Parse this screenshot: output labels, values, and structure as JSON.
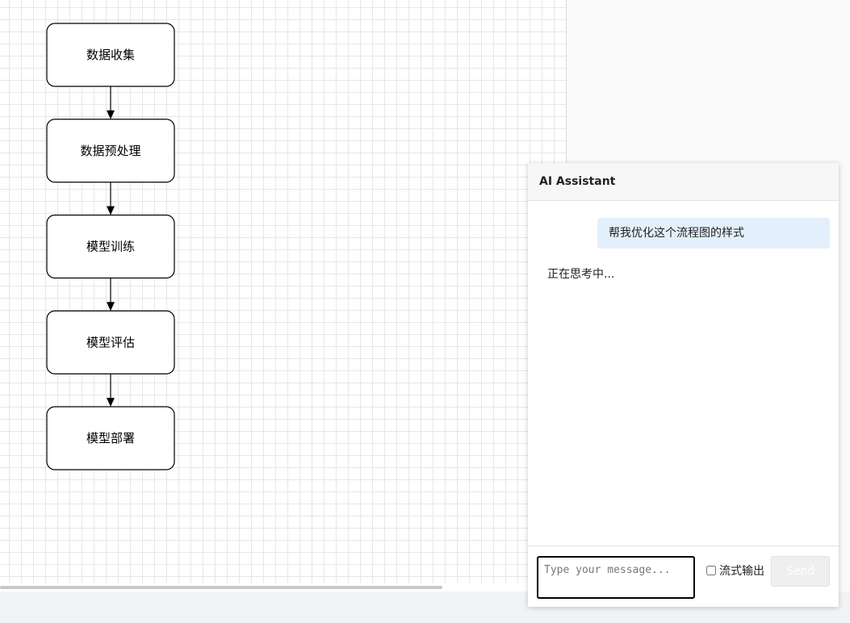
{
  "diagram": {
    "nodes": [
      "数据收集",
      "数据预处理",
      "模型训练",
      "模型评估",
      "模型部署"
    ]
  },
  "ai_panel": {
    "title": "AI Assistant",
    "messages": {
      "user": "帮我优化这个流程图的样式",
      "assistant": "正在思考中..."
    },
    "input_placeholder": "Type your message...",
    "stream_label": "流式输出",
    "stream_checked": false,
    "send_label": "Send"
  }
}
